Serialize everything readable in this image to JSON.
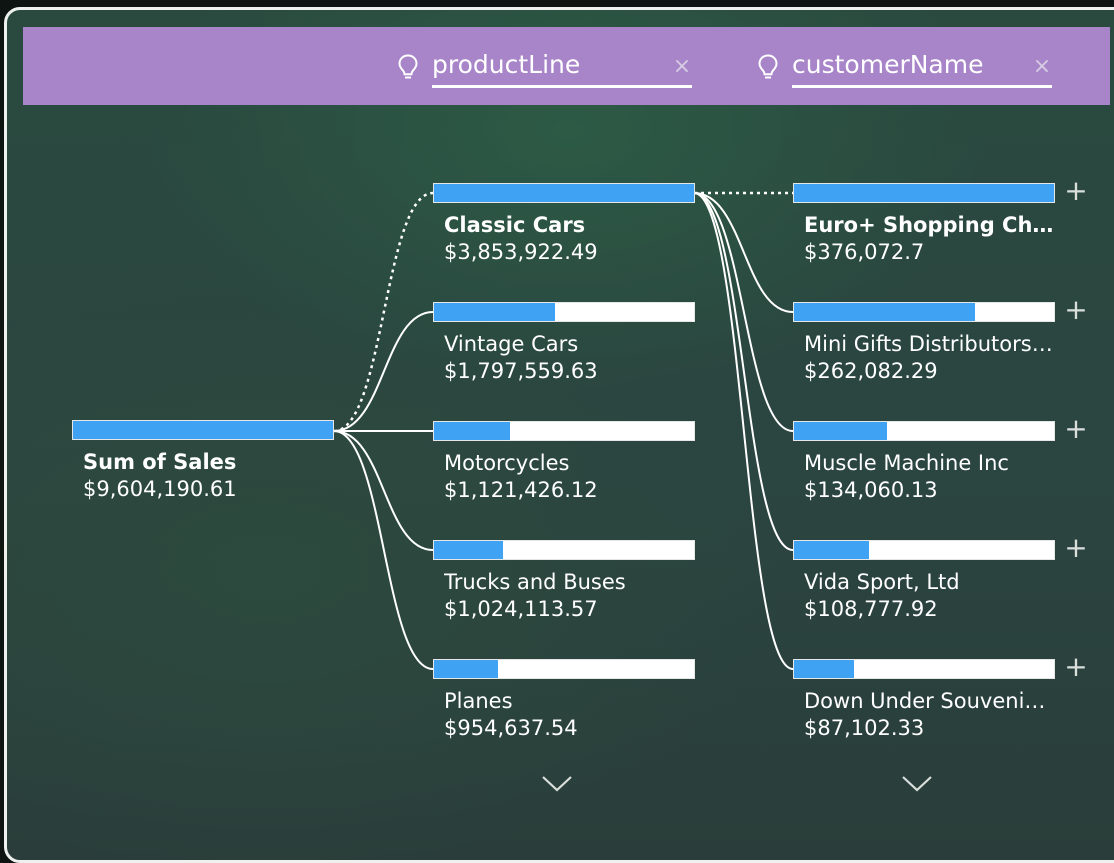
{
  "levels": [
    {
      "title": "productLine",
      "icon": "lightbulb-icon"
    },
    {
      "title": "customerName",
      "icon": "lightbulb-icon"
    }
  ],
  "root": {
    "label": "Sum of Sales",
    "value": "$9,604,190.61",
    "fill": 1.0
  },
  "product_lines": [
    {
      "label": "Classic Cars",
      "value": "$3,853,922.49",
      "fill": 1.0,
      "selected": true
    },
    {
      "label": "Vintage Cars",
      "value": "$1,797,559.63",
      "fill": 0.466
    },
    {
      "label": "Motorcycles",
      "value": "$1,121,426.12",
      "fill": 0.291
    },
    {
      "label": "Trucks and Buses",
      "value": "$1,024,113.57",
      "fill": 0.266
    },
    {
      "label": "Planes",
      "value": "$954,637.54",
      "fill": 0.248
    }
  ],
  "customers": [
    {
      "label": "Euro+ Shopping Cha...",
      "value": "$376,072.7",
      "fill": 1.0,
      "selected": true
    },
    {
      "label": "Mini Gifts Distributors ...",
      "value": "$262,082.29",
      "fill": 0.697
    },
    {
      "label": "Muscle Machine Inc",
      "value": "$134,060.13",
      "fill": 0.356
    },
    {
      "label": "Vida Sport, Ltd",
      "value": "$108,777.92",
      "fill": 0.289
    },
    {
      "label": "Down Under Souvenie...",
      "value": "$87,102.33",
      "fill": 0.232
    }
  ],
  "close_glyph": "×",
  "expand_glyph": "+",
  "colors": {
    "accent": "#40a2f3",
    "header": "#a884c9",
    "track": "#ffffff"
  }
}
